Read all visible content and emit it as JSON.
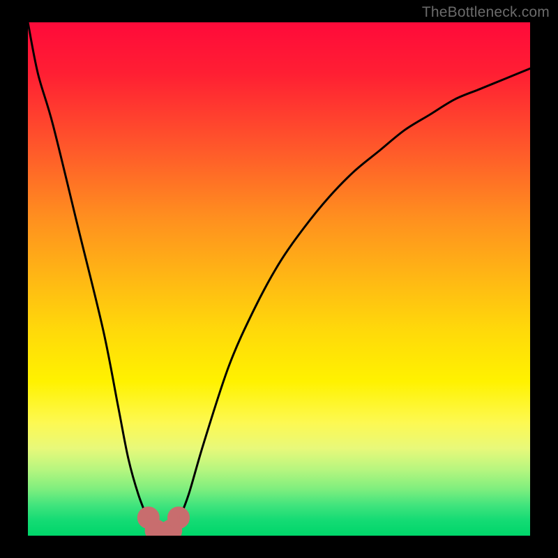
{
  "attribution": "TheBottleneck.com",
  "chart_data": {
    "type": "line",
    "title": "",
    "xlabel": "",
    "ylabel": "",
    "xlim": [
      0,
      100
    ],
    "ylim": [
      0,
      100
    ],
    "series": [
      {
        "name": "bottleneck-curve",
        "x": [
          0,
          2,
          5,
          10,
          15,
          18,
          20,
          22,
          24,
          25,
          26,
          27,
          28,
          29,
          30,
          32,
          35,
          40,
          45,
          50,
          55,
          60,
          65,
          70,
          75,
          80,
          85,
          90,
          95,
          100
        ],
        "values": [
          100,
          90,
          80,
          60,
          40,
          25,
          15,
          8,
          3,
          1,
          0,
          0,
          0,
          1,
          3,
          8,
          18,
          33,
          44,
          53,
          60,
          66,
          71,
          75,
          79,
          82,
          85,
          87,
          89,
          91
        ]
      },
      {
        "name": "marker-band",
        "x": [
          24.0,
          25.5,
          27.0,
          28.5,
          30.0
        ],
        "values": [
          3.5,
          1.0,
          0.5,
          1.0,
          3.5
        ]
      }
    ],
    "colors": {
      "curve": "#000000",
      "markers": "#c86d6e",
      "gradient_top": "#ff0a3a",
      "gradient_bottom": "#00d66a"
    }
  }
}
